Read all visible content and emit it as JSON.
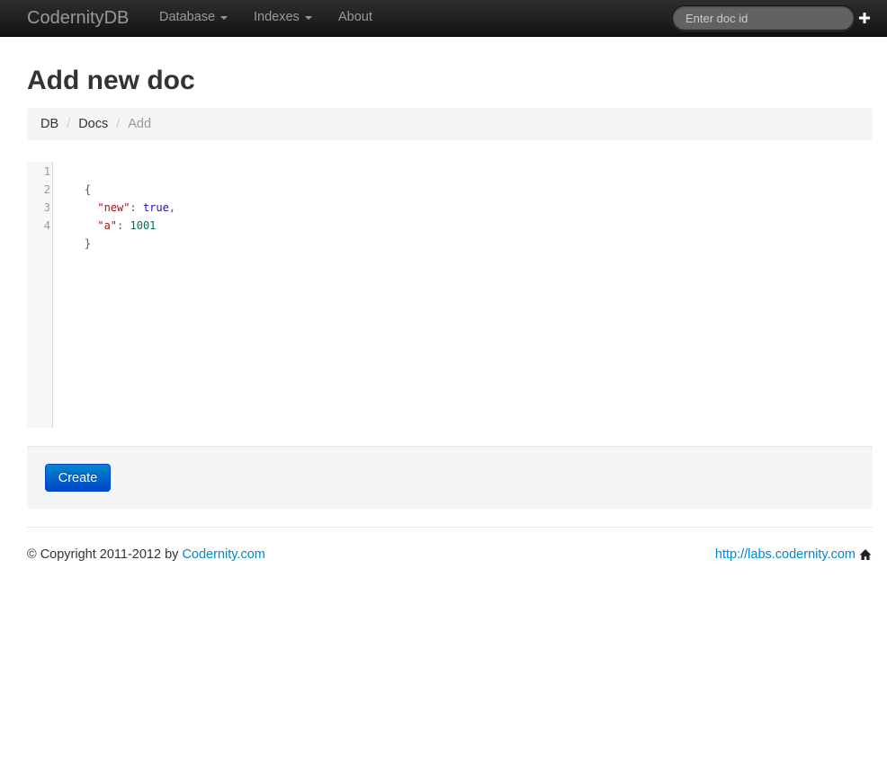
{
  "navbar": {
    "brand": "CodernityDB",
    "items": [
      {
        "label": "Database",
        "dropdown": true
      },
      {
        "label": "Indexes",
        "dropdown": true
      },
      {
        "label": "About",
        "dropdown": false
      }
    ],
    "search": {
      "placeholder": "Enter doc id",
      "value": ""
    },
    "add_icon": "plus-icon"
  },
  "page": {
    "title": "Add new doc"
  },
  "breadcrumb": {
    "items": [
      "DB",
      "Docs",
      "Add"
    ],
    "separator": "/"
  },
  "editor": {
    "line_numbers": [
      "1",
      "2",
      "3",
      "4"
    ],
    "lines": [
      [
        {
          "t": "punc",
          "v": "{"
        }
      ],
      [
        {
          "t": "punc",
          "v": "  "
        },
        {
          "t": "string",
          "v": "\"new\""
        },
        {
          "t": "punc",
          "v": ": "
        },
        {
          "t": "atom",
          "v": "true"
        },
        {
          "t": "punc",
          "v": ","
        }
      ],
      [
        {
          "t": "punc",
          "v": "  "
        },
        {
          "t": "string",
          "v": "\"a\""
        },
        {
          "t": "punc",
          "v": ": "
        },
        {
          "t": "number",
          "v": "1001"
        }
      ],
      [
        {
          "t": "punc",
          "v": "}"
        }
      ]
    ]
  },
  "actions": {
    "create_label": "Create"
  },
  "footer": {
    "copyright_prefix": "© Copyright 2011-2012 by ",
    "copyright_link": "Codernity.com",
    "labs_link": "http://labs.codernity.com",
    "home_icon": "home-icon"
  },
  "colors": {
    "navbar_bg": "#222222",
    "link": "#0088cc",
    "primary_button": "#0055cc",
    "breadcrumb_bg": "#f5f5f5"
  }
}
